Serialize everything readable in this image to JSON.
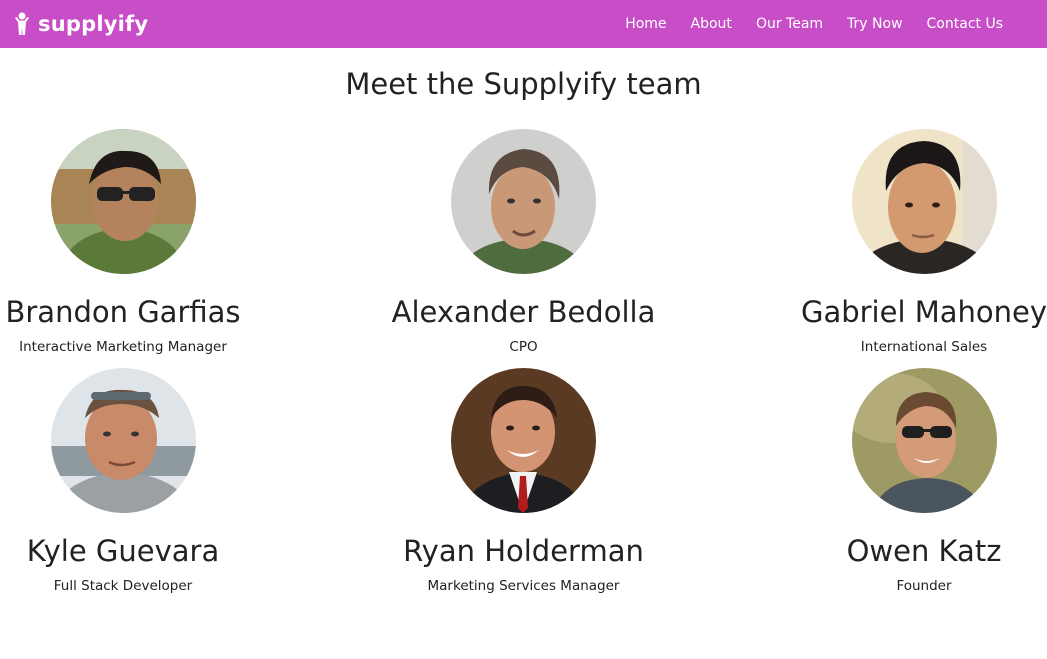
{
  "nav": {
    "brand": "supplyify",
    "links": [
      "Home",
      "About",
      "Our Team",
      "Try Now",
      "Contact Us"
    ]
  },
  "page": {
    "title": "Meet the Supplyify team"
  },
  "team": [
    {
      "name": "Brandon Garfias",
      "role": "Interactive Marketing Manager"
    },
    {
      "name": "Alexander Bedolla",
      "role": "CPO"
    },
    {
      "name": "Gabriel Mahoney",
      "role": "International Sales"
    },
    {
      "name": "Kyle Guevara",
      "role": "Full Stack Developer"
    },
    {
      "name": "Ryan Holderman",
      "role": "Marketing Services Manager"
    },
    {
      "name": "Owen Katz",
      "role": "Founder"
    }
  ],
  "colors": {
    "navbar": "#c84ec8",
    "text": "#222222",
    "background": "#ffffff"
  }
}
